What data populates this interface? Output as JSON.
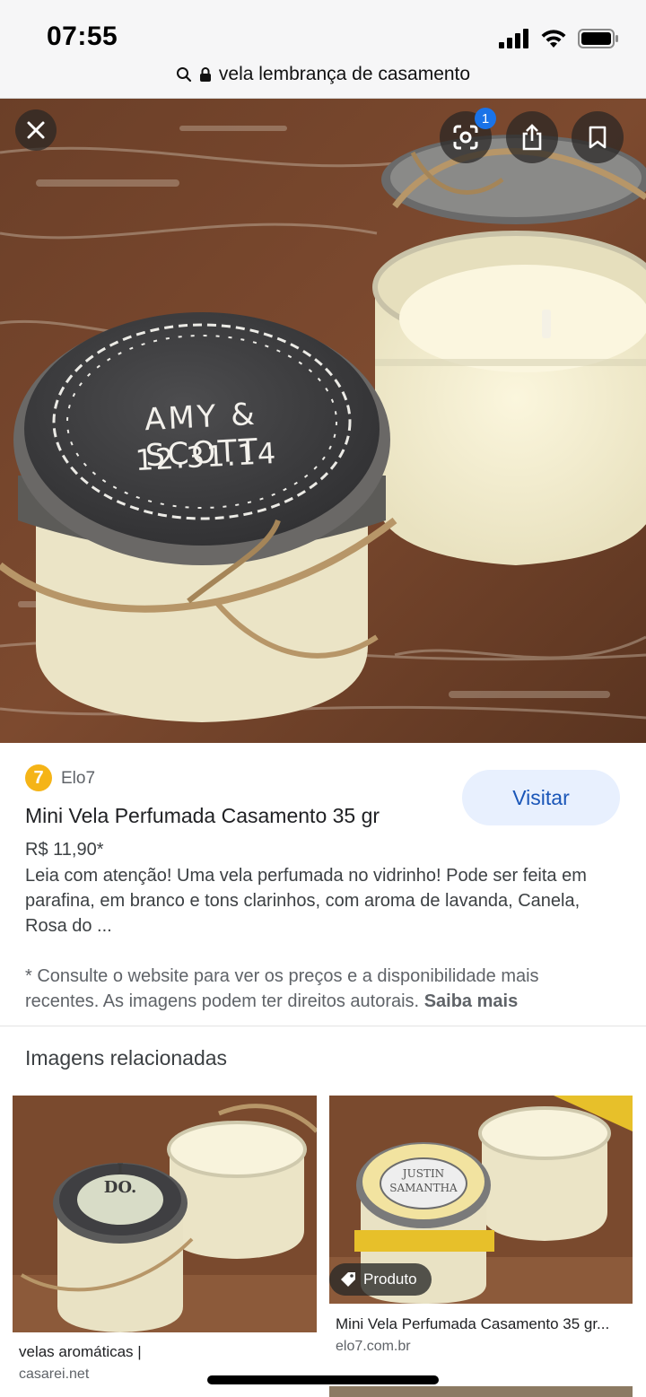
{
  "status_bar": {
    "time": "07:55",
    "icons": [
      "signal-icon",
      "wifi-icon",
      "battery-icon"
    ]
  },
  "browser": {
    "url_text": "vela lembrança de casamento"
  },
  "hero": {
    "lens_badge_count": "1",
    "lid_text_line1": "AMY & SCOTT",
    "lid_text_line2": "12.31.14",
    "buttons": [
      "close-icon",
      "lens-icon",
      "share-icon",
      "bookmark-icon"
    ]
  },
  "result": {
    "source_logo": "7",
    "source_name": "Elo7",
    "visit_label": "Visitar",
    "title": "Mini Vela Perfumada Casamento 35 gr",
    "price": "R$ 11,90*",
    "description": "Leia com atenção! Uma vela perfumada no vidrinho! Pode ser feita em parafina, em branco e tons clarinhos, com aroma de lavanda, Canela, Rosa do ...",
    "notice": "* Consulte o website para ver os preços e a disponibilidade mais recentes. As imagens podem ter direitos autorais.",
    "notice_link": "Saiba mais"
  },
  "related": {
    "heading": "Imagens relacionadas",
    "items": [
      {
        "caption": "velas aromáticas |",
        "source": "casarei.net",
        "lid_line1": "I",
        "lid_line2": "DO."
      },
      {
        "tag": "Produto",
        "caption": "Mini Vela Perfumada Casamento 35 gr...",
        "source": "elo7.com.br",
        "lid_line1": "JUSTIN",
        "lid_line2": "SAMANTHA"
      }
    ]
  },
  "colors": {
    "accent": "#1a73e8",
    "visit_bg": "#e8f0fe",
    "visit_text": "#1a56b8",
    "logo": "#f5b417"
  }
}
